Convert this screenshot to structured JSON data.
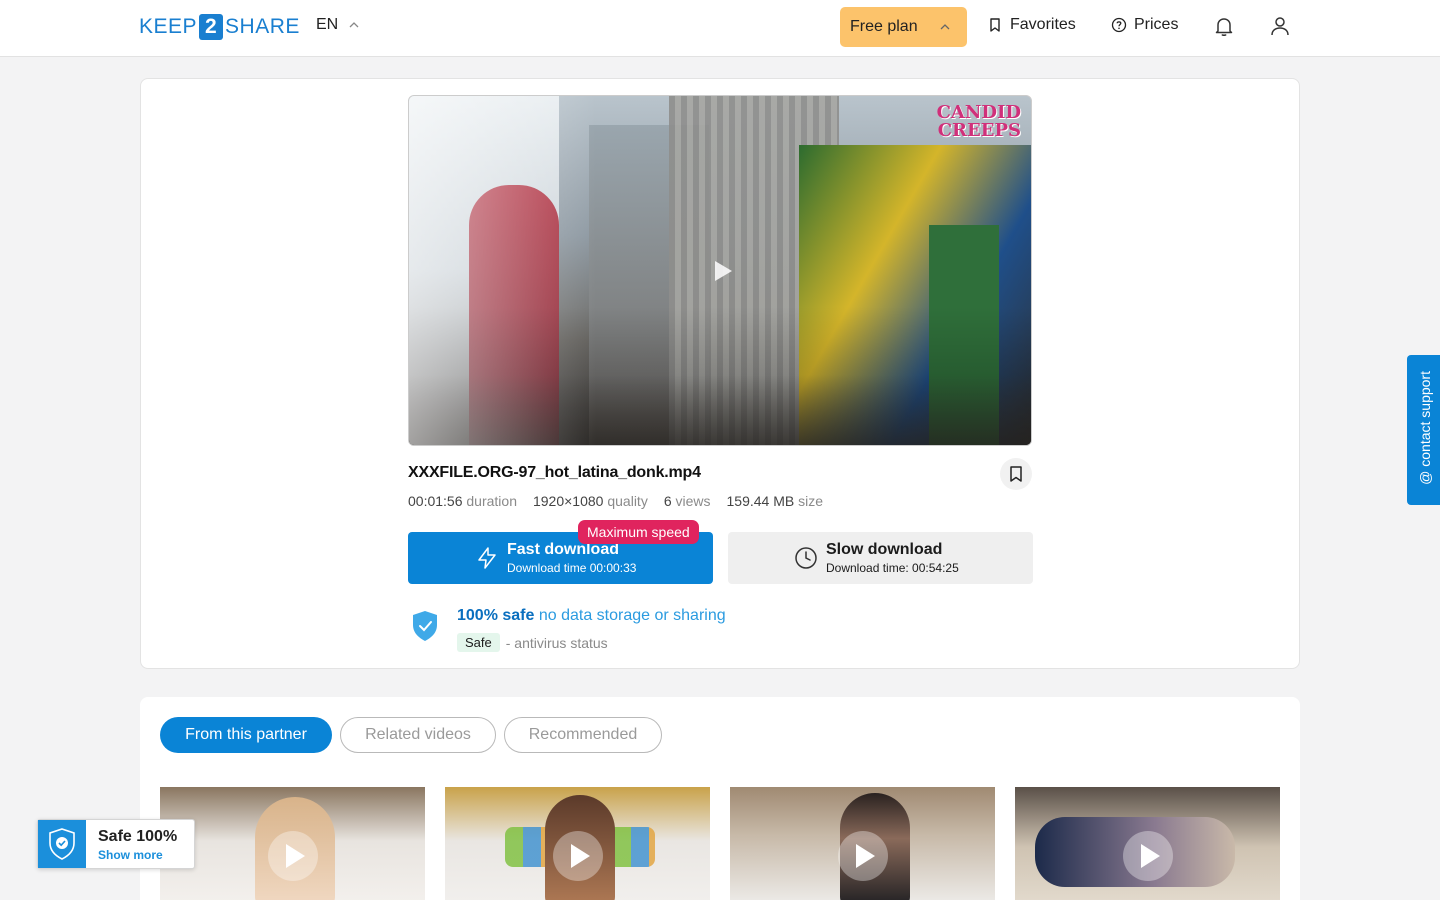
{
  "header": {
    "logo_left": "KEEP",
    "logo_mid": "2",
    "logo_right": "SHARE",
    "language": "EN",
    "plan_label": "Free plan",
    "favorites_label": "Favorites",
    "prices_label": "Prices",
    "bell_icon": "bell-icon",
    "user_icon": "user-icon"
  },
  "file": {
    "name": "XXXFILE.ORG-97_hot_latina_donk.mp4",
    "watermark_line1": "CANDID",
    "watermark_line2": "CREEPS",
    "duration_value": "00:01:56",
    "duration_label": "duration",
    "quality_value": "1920×1080",
    "quality_label": "quality",
    "views_value": "6",
    "views_label": "views",
    "size_value": "159.44 MB",
    "size_label": "size"
  },
  "download": {
    "fast_title": "Fast download",
    "fast_sub": "Download time 00:00:33",
    "max_badge": "Maximum speed",
    "slow_title": "Slow download",
    "slow_sub": "Download time: 00:54:25"
  },
  "safety": {
    "headline": "100% safe",
    "headline_rest": "no data storage or sharing",
    "status_pill": "Safe",
    "status_text": "- antivirus status"
  },
  "tabs": [
    {
      "label": "From this partner"
    },
    {
      "label": "Related videos"
    },
    {
      "label": "Recommended"
    }
  ],
  "widget": {
    "title": "Safe 100%",
    "link": "Show more"
  },
  "support_label": "contact support",
  "colors": {
    "primary": "#0a84d6",
    "plan": "#fcc36b",
    "badge": "#e0245e"
  }
}
